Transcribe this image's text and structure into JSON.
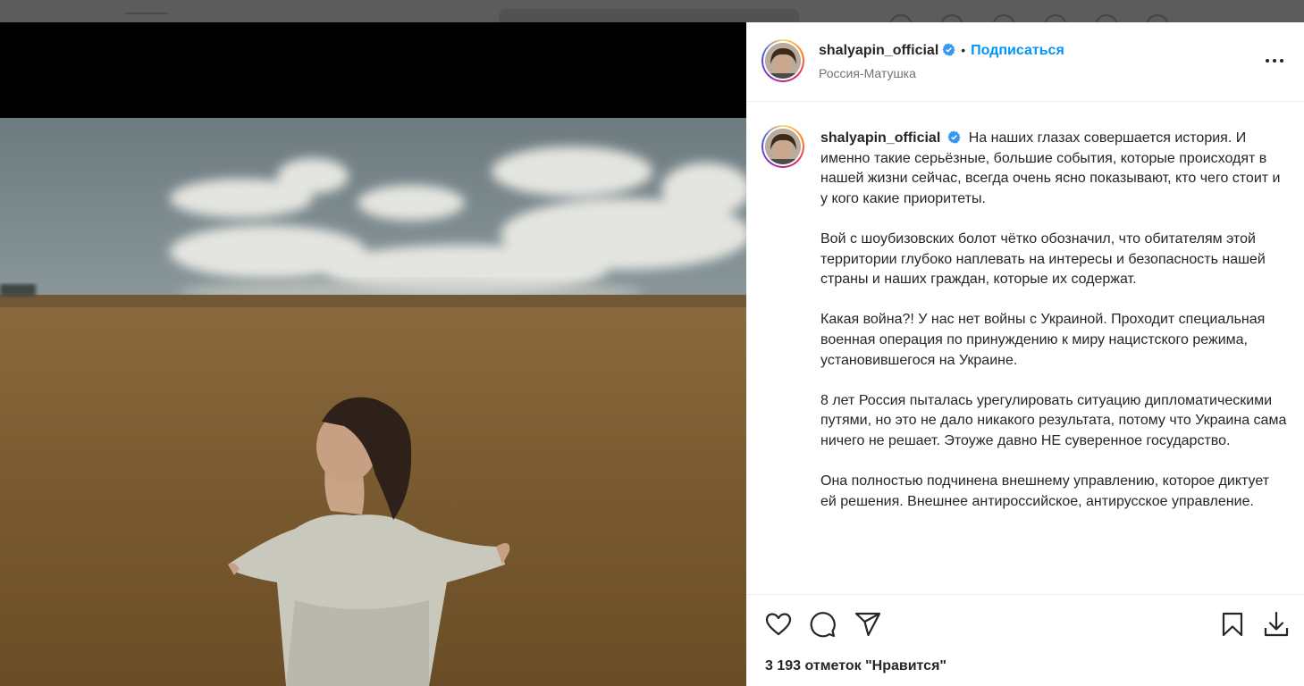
{
  "post": {
    "username": "shalyapin_official",
    "follow_label": "Подписаться",
    "location": "Россия-Матушка",
    "caption_paragraphs": [
      "На наших глазах совершается история. И именно такие серьёзные, большие события, которые происходят в нашей жизни сейчас, всегда очень ясно показывают, кто чего стоит и у кого какие приоритеты.",
      "Вой с шоубизовских болот чётко обозначил, что обитателям этой территории глубоко наплевать на интересы и безопасность нашей страны и наших граждан, которые их содержат.",
      "Какая война?! У нас нет войны с Украиной. Проходит специальная военная операция по принуждению к миру нацистского режима, установившегося на Украине.",
      "8 лет Россия пыталась урегулировать ситуацию дипломатическими путями, но это не дало никакого результата, потому что Украина сама ничего не решает. Этоуже давно НЕ суверенное государство.",
      "Она полностью подчинена внешнему управлению, которое диктует ей решения. Внешнее антироссийское, антирусское управление."
    ],
    "likes_text": "3 193 отметок \"Нравится\""
  },
  "colors": {
    "accent": "#0095f6",
    "text": "#262626",
    "secondary_text": "#737373",
    "verified_badge": "#3897f0"
  },
  "icons": {
    "verified": "verified-badge-icon",
    "more": "more-options-icon",
    "like": "heart-icon",
    "comment": "comment-icon",
    "share": "share-icon",
    "save": "bookmark-icon",
    "download": "download-icon"
  }
}
